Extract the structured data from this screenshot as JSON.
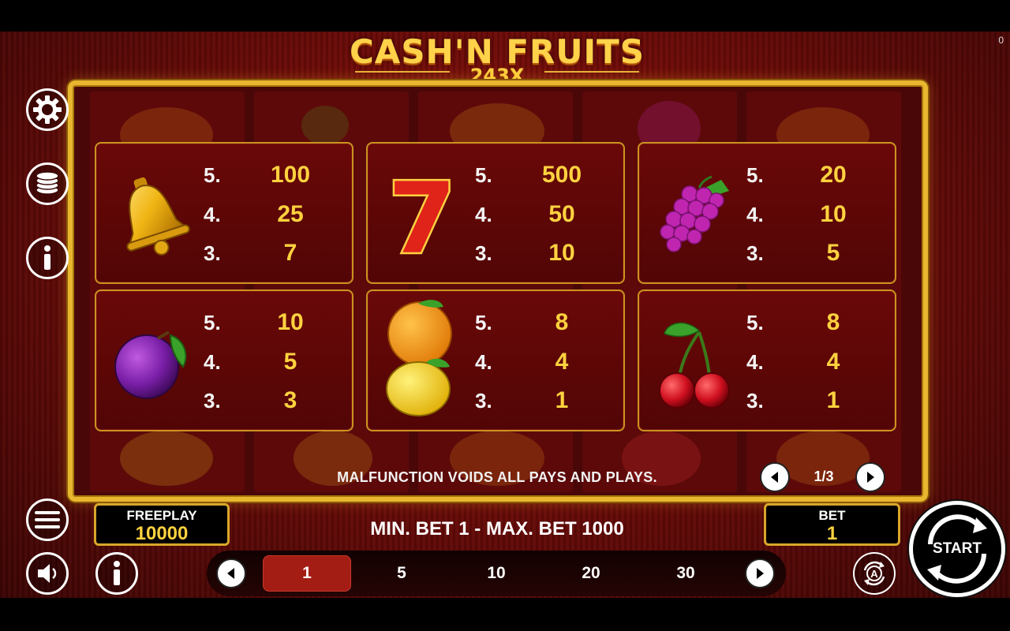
{
  "corner_counter": "0",
  "logo": {
    "title": "CASH'N FRUITS",
    "subtitle": "243X"
  },
  "paytable": [
    {
      "symbol": "bell-icon",
      "rows": [
        {
          "count": "5.",
          "payout": "100"
        },
        {
          "count": "4.",
          "payout": "25"
        },
        {
          "count": "3.",
          "payout": "7"
        }
      ]
    },
    {
      "symbol": "seven-icon",
      "glyph": "7",
      "rows": [
        {
          "count": "5.",
          "payout": "500"
        },
        {
          "count": "4.",
          "payout": "50"
        },
        {
          "count": "3.",
          "payout": "10"
        }
      ]
    },
    {
      "symbol": "grapes-icon",
      "rows": [
        {
          "count": "5.",
          "payout": "20"
        },
        {
          "count": "4.",
          "payout": "10"
        },
        {
          "count": "3.",
          "payout": "5"
        }
      ]
    },
    {
      "symbol": "plum-icon",
      "rows": [
        {
          "count": "5.",
          "payout": "10"
        },
        {
          "count": "4.",
          "payout": "5"
        },
        {
          "count": "3.",
          "payout": "3"
        }
      ]
    },
    {
      "symbol": "orange-lemon-icon",
      "rows": [
        {
          "count": "5.",
          "payout": "8"
        },
        {
          "count": "4.",
          "payout": "4"
        },
        {
          "count": "3.",
          "payout": "1"
        }
      ]
    },
    {
      "symbol": "cherry-icon",
      "rows": [
        {
          "count": "5.",
          "payout": "8"
        },
        {
          "count": "4.",
          "payout": "4"
        },
        {
          "count": "3.",
          "payout": "1"
        }
      ]
    }
  ],
  "malfunction_text": "MALFUNCTION VOIDS ALL PAYS AND PLAYS.",
  "pagination": {
    "label": "1/3"
  },
  "sidebar": {
    "icons": [
      "gear-icon",
      "coins-icon",
      "info-icon"
    ]
  },
  "freeplay": {
    "label": "FREEPLAY",
    "value": "10000"
  },
  "bet_limits": "MIN. BET 1 - MAX. BET 1000",
  "bet": {
    "label": "BET",
    "value": "1"
  },
  "bet_options": [
    "1",
    "5",
    "10",
    "20",
    "30"
  ],
  "selected_bet": "1",
  "start_label": "START",
  "colors": {
    "gold": "#ffd23f",
    "frame": "#e9b72f",
    "selected": "#a31d14",
    "background": "#6d0b08"
  }
}
